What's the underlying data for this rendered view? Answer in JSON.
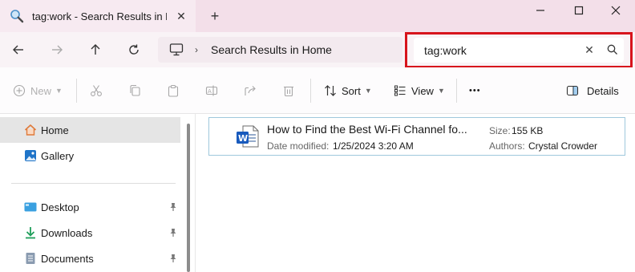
{
  "window": {
    "tab_title": "tag:work - Search Results in Ho",
    "new_tab_symbol": "+",
    "close_tab_symbol": "✕"
  },
  "address": {
    "location_icon": "computer-icon",
    "separator": "›",
    "breadcrumb": "Search Results in Home"
  },
  "search": {
    "query": "tag:work",
    "clear_symbol": "✕",
    "highlight_color": "#d7141c"
  },
  "toolbar": {
    "new_label": "New",
    "sort_label": "Sort",
    "view_label": "View",
    "more_symbol": "•••",
    "details_label": "Details"
  },
  "sidebar": {
    "items": [
      {
        "label": "Home",
        "icon": "home-icon",
        "selected": true
      },
      {
        "label": "Gallery",
        "icon": "gallery-icon"
      },
      {
        "label": "Desktop",
        "icon": "desktop-icon",
        "pinned": true
      },
      {
        "label": "Downloads",
        "icon": "downloads-icon",
        "pinned": true
      },
      {
        "label": "Documents",
        "icon": "documents-icon",
        "pinned": true
      }
    ]
  },
  "results": [
    {
      "name": "How to Find the Best Wi-Fi Channel fo...",
      "date_modified_label": "Date modified:",
      "date_modified": "1/25/2024 3:20 AM",
      "size_label": "Size:",
      "size": "155 KB",
      "authors_label": "Authors:",
      "authors": "Crystal Crowder",
      "icon": "word-document-icon"
    }
  ],
  "colors": {
    "titlebar": "#f3dfe9",
    "accent": "#0078d4",
    "card_border": "#9fc8dc"
  }
}
